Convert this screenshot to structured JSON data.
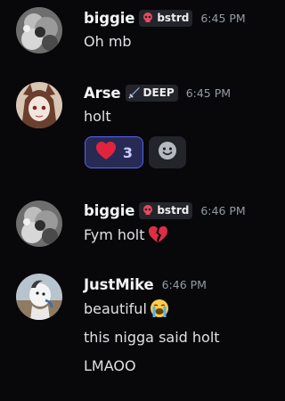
{
  "messages": [
    {
      "username": "biggie",
      "tag": "bstrd",
      "tag_icon": "skull-icon",
      "time": "6:45 PM",
      "lines": [
        "Oh mb"
      ]
    },
    {
      "username": "Arse",
      "tag": "DEEP",
      "tag_icon": "sword-icon",
      "time": "6:45 PM",
      "lines": [
        "holt"
      ],
      "reaction": {
        "emoji": "red-heart",
        "count": "3"
      }
    },
    {
      "username": "biggie",
      "tag": "bstrd",
      "tag_icon": "skull-icon",
      "time": "6:46 PM",
      "lines": [
        "Fym holt"
      ],
      "line_emoji": "broken-heart"
    },
    {
      "username": "JustMike",
      "time": "6:46 PM",
      "lines": [
        "beautiful",
        "this nigga said holt",
        "LMAOO"
      ],
      "line_emoji": "loudly-crying-face"
    }
  ],
  "colors": {
    "background": "#08080a",
    "username": "#f2f3f5",
    "timestamp": "#949ba4",
    "reaction_accent": "#5865f2"
  }
}
